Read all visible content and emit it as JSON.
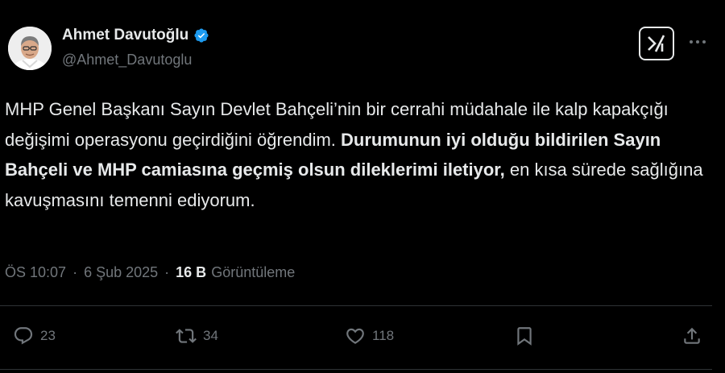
{
  "author": {
    "name": "Ahmet Davutoğlu",
    "handle": "@Ahmet_Davutoglu",
    "verified": true
  },
  "tweet": {
    "text_part1": "MHP Genel Başkanı Sayın Devlet Bahçeli’nin bir cerrahi müdahale ile kalp kapakçığı değişimi operasyonu geçirdiğini öğrendim. ",
    "text_bold": "Durumunun iyi olduğu bildirilen Sayın Bahçeli ve MHP camiasına geçmiş olsun dileklerimi iletiyor,",
    "text_part2": " en kısa sürede sağlığına kavuşmasını temenni ediyorum."
  },
  "meta": {
    "time": "ÖS 10:07",
    "separator": "·",
    "date": "6 Şub 2025",
    "views_count": "16 B",
    "views_label": "Görüntüleme"
  },
  "actions": {
    "replies": "23",
    "reposts": "34",
    "likes": "118"
  },
  "colors": {
    "background": "#000000",
    "text": "#e7e9ea",
    "secondary": "#71767b",
    "verified": "#1d9bf0"
  },
  "icons": [
    "verified-badge-icon",
    "grok-icon",
    "more-icon",
    "reply-icon",
    "repost-icon",
    "like-icon",
    "bookmark-icon",
    "share-icon"
  ]
}
